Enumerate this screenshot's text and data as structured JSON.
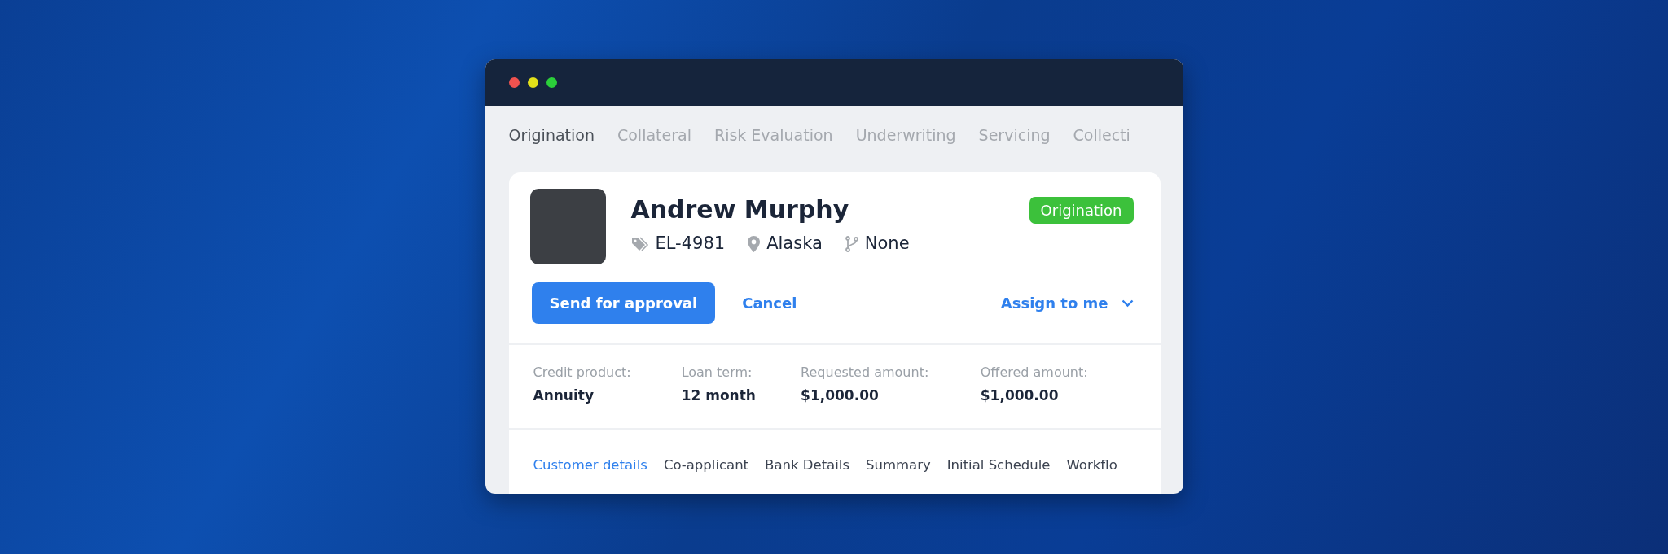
{
  "stage_tabs": [
    {
      "label": "Origination",
      "selected": true
    },
    {
      "label": "Collateral",
      "selected": false
    },
    {
      "label": "Risk Evaluation",
      "selected": false
    },
    {
      "label": "Underwriting",
      "selected": false
    },
    {
      "label": "Servicing",
      "selected": false
    },
    {
      "label": "Collecti",
      "selected": false
    }
  ],
  "customer": {
    "name": "Andrew Murphy",
    "status": "Origination",
    "id": "EL-4981",
    "location": "Alaska",
    "branch": "None"
  },
  "actions": {
    "primary": "Send for approval",
    "cancel": "Cancel",
    "assign": "Assign to me"
  },
  "summary": [
    {
      "label": "Credit product:",
      "value": "Annuity"
    },
    {
      "label": "Loan term:",
      "value": "12 month"
    },
    {
      "label": "Requested amount:",
      "value": "$1,000.00"
    },
    {
      "label": "Offered amount:",
      "value": "$1,000.00"
    }
  ],
  "detail_tabs": [
    {
      "label": "Customer details",
      "selected": true
    },
    {
      "label": "Co-applicant",
      "selected": false
    },
    {
      "label": "Bank Details",
      "selected": false
    },
    {
      "label": "Summary",
      "selected": false
    },
    {
      "label": "Initial Schedule",
      "selected": false
    },
    {
      "label": "Workflo",
      "selected": false
    }
  ]
}
